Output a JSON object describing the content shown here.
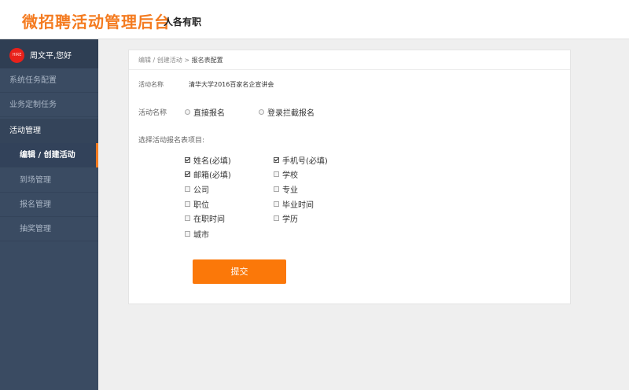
{
  "header": {
    "brand": "微招聘活动管理后台",
    "tagline": "人各有职"
  },
  "sidebar": {
    "avatar_text": "HIRE",
    "user_greeting": "周文平,您好",
    "items": [
      {
        "label": "系统任务配置"
      },
      {
        "label": "业务定制任务"
      },
      {
        "label": "活动管理"
      },
      {
        "label": "编辑 / 创建活动"
      },
      {
        "label": "到场管理"
      },
      {
        "label": "报名管理"
      },
      {
        "label": "抽奖管理"
      }
    ]
  },
  "breadcrumb": {
    "link": "编辑 / 创建活动",
    "separator": ">",
    "current": "报名表配置"
  },
  "form": {
    "activity_name_label": "活动名称",
    "activity_name_value": "清华大学2016百家名企宣讲会",
    "signup_type_label": "活动名称",
    "signup_options": [
      {
        "label": "直接报名",
        "selected": false
      },
      {
        "label": "登录拦截报名",
        "selected": false
      }
    ],
    "fields_label": "选择活动报名表项目:",
    "fields": [
      {
        "label": "姓名(必填)",
        "checked": true
      },
      {
        "label": "手机号(必填)",
        "checked": true
      },
      {
        "label": "邮箱(必填)",
        "checked": true
      },
      {
        "label": "学校",
        "checked": false
      },
      {
        "label": "公司",
        "checked": false
      },
      {
        "label": "专业",
        "checked": false
      },
      {
        "label": "职位",
        "checked": false
      },
      {
        "label": "毕业时间",
        "checked": false
      },
      {
        "label": "在职时间",
        "checked": false
      },
      {
        "label": "学历",
        "checked": false
      },
      {
        "label": "城市",
        "checked": false
      }
    ],
    "submit_label": "提交"
  },
  "colors": {
    "accent": "#f47b20",
    "button": "#fb7809",
    "sidebar_bg": "#3a4b62"
  }
}
